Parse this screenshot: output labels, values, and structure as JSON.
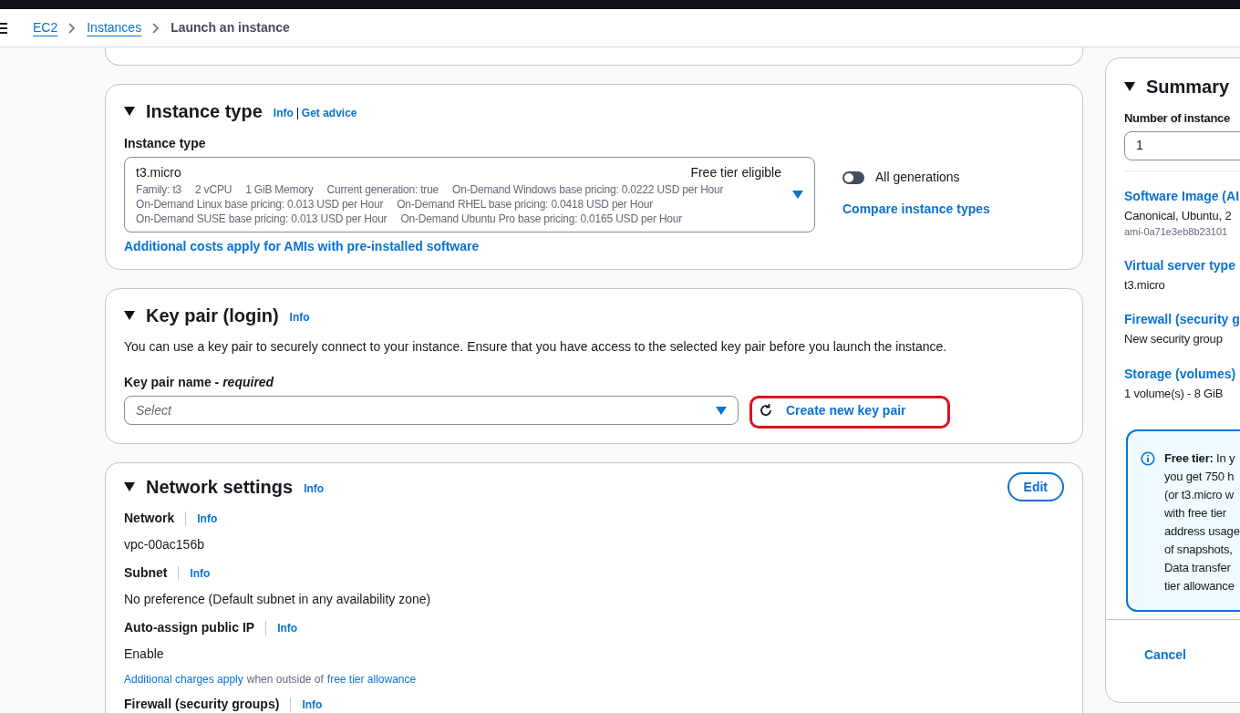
{
  "breadcrumb": [
    {
      "label": "EC2",
      "kind": "link"
    },
    {
      "label": "Instances",
      "kind": "link"
    },
    {
      "label": "Launch an instance",
      "kind": "current"
    }
  ],
  "instance_type": {
    "title": "Instance type",
    "info": "Info",
    "advice": "Get advice",
    "field_label": "Instance type",
    "selected": {
      "name": "t3.micro",
      "badge": "Free tier eligible",
      "details": [
        [
          "Family: t3",
          "2 vCPU",
          "1 GiB Memory",
          "Current generation: true",
          "On-Demand Windows base pricing: 0.0222 USD per Hour"
        ],
        [
          "On-Demand Linux base pricing: 0.013 USD per Hour",
          "On-Demand RHEL base pricing: 0.0418 USD per Hour"
        ],
        [
          "On-Demand SUSE base pricing: 0.013 USD per Hour",
          "On-Demand Ubuntu Pro base pricing: 0.0165 USD per Hour"
        ]
      ]
    },
    "toggle": {
      "label": "All generations",
      "on": false
    },
    "compare": "Compare instance types",
    "costs_link": "Additional costs apply for AMIs with pre-installed software"
  },
  "key_pair": {
    "title": "Key pair (login)",
    "info": "Info",
    "description": "You can use a key pair to securely connect to your instance. Ensure that you have access to the selected key pair before you launch the instance.",
    "field_label": "Key pair name - *required*",
    "placeholder": "Select",
    "create_button": {
      "label": "Create new key pair",
      "highlighted": true
    }
  },
  "network": {
    "title": "Network settings",
    "info": "Info",
    "edit": "Edit",
    "fields": [
      {
        "label": "Network",
        "info": "Info",
        "value": "vpc-00ac156b"
      },
      {
        "label": "Subnet",
        "info": "Info",
        "value": "No preference (Default subnet in any availability zone)"
      },
      {
        "label": "Auto-assign public IP",
        "info": "Info",
        "value": "Enable"
      }
    ],
    "charges_note": {
      "link1": "Additional charges apply",
      "text": "when outside of",
      "link2": "free tier allowance"
    },
    "firewall": {
      "label": "Firewall (security groups)",
      "info": "Info"
    }
  },
  "summary": {
    "title": "Summary",
    "count_label": "Number of instance",
    "count": "1",
    "items": [
      {
        "label": "Software Image (AI",
        "value": "Canonical, Ubuntu, 2",
        "sub": "ami-0a71e3eb8b23101"
      },
      {
        "label": "Virtual server type",
        "value": "t3.micro"
      },
      {
        "label": "Firewall (security g",
        "value": "New security group"
      },
      {
        "label": "Storage (volumes)",
        "value": "1 volume(s) - 8 GiB"
      }
    ],
    "free_tier": [
      "**Free tier:** In y",
      "you get 750 h",
      "(or t3.micro w",
      "with free tier",
      "address usage",
      "of snapshots,",
      "Data transfer",
      "tier allowance"
    ],
    "cancel": "Cancel"
  }
}
